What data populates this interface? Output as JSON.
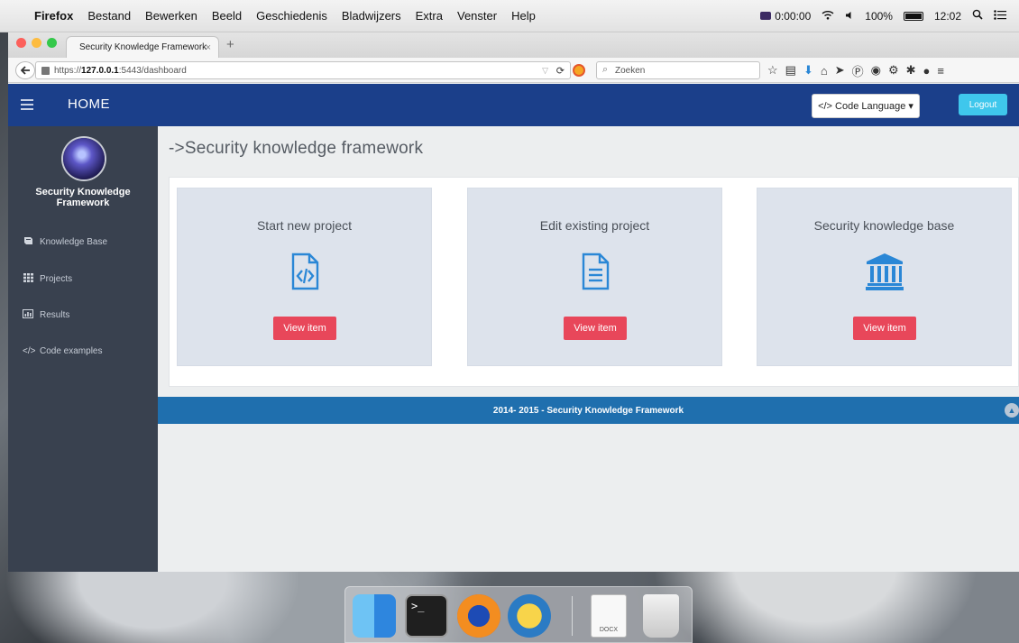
{
  "menubar": {
    "apple_glyph": "",
    "app_name": "Firefox",
    "items": [
      "Bestand",
      "Bewerken",
      "Beeld",
      "Geschiedenis",
      "Bladwijzers",
      "Extra",
      "Venster",
      "Help"
    ],
    "recording_time": "0:00:00",
    "battery": "100%",
    "clock": "12:02"
  },
  "browser": {
    "tab_title": "Security Knowledge Framework",
    "tab_close": "×",
    "new_tab": "+",
    "url_prefix": "https://",
    "url_host": "127.0.0.1",
    "url_path": ":5443/dashboard",
    "search_placeholder": "Zoeken"
  },
  "app": {
    "nav_title": "HOME",
    "code_language_label": "</> Code Language ▾",
    "logout_label": "Logout",
    "brand": "Security Knowledge Framework",
    "sidebar_items": [
      {
        "label": "Knowledge Base",
        "icon": "book-icon"
      },
      {
        "label": "Projects",
        "icon": "grid-icon"
      },
      {
        "label": "Results",
        "icon": "chart-icon"
      },
      {
        "label": "Code examples",
        "icon": "code-icon"
      }
    ],
    "page_heading": "->Security knowledge framework",
    "cards": [
      {
        "title": "Start new project",
        "icon": "code-file-icon",
        "button": "View item"
      },
      {
        "title": "Edit existing project",
        "icon": "document-icon",
        "button": "View item"
      },
      {
        "title": "Security knowledge base",
        "icon": "institution-icon",
        "button": "View item"
      }
    ],
    "footer": "2014- 2015 - Security Knowledge Framework"
  },
  "dock": {
    "terminal_prompt": ">_",
    "docx_label": "DOCX"
  },
  "colors": {
    "nav_blue": "#1b3f8a",
    "sidebar": "#39414f",
    "card_bg": "#dde3ec",
    "accent_red": "#e8475a",
    "icon_blue": "#2a87d6",
    "footer_blue": "#1f6fae",
    "logout_cyan": "#3fc7ec"
  }
}
